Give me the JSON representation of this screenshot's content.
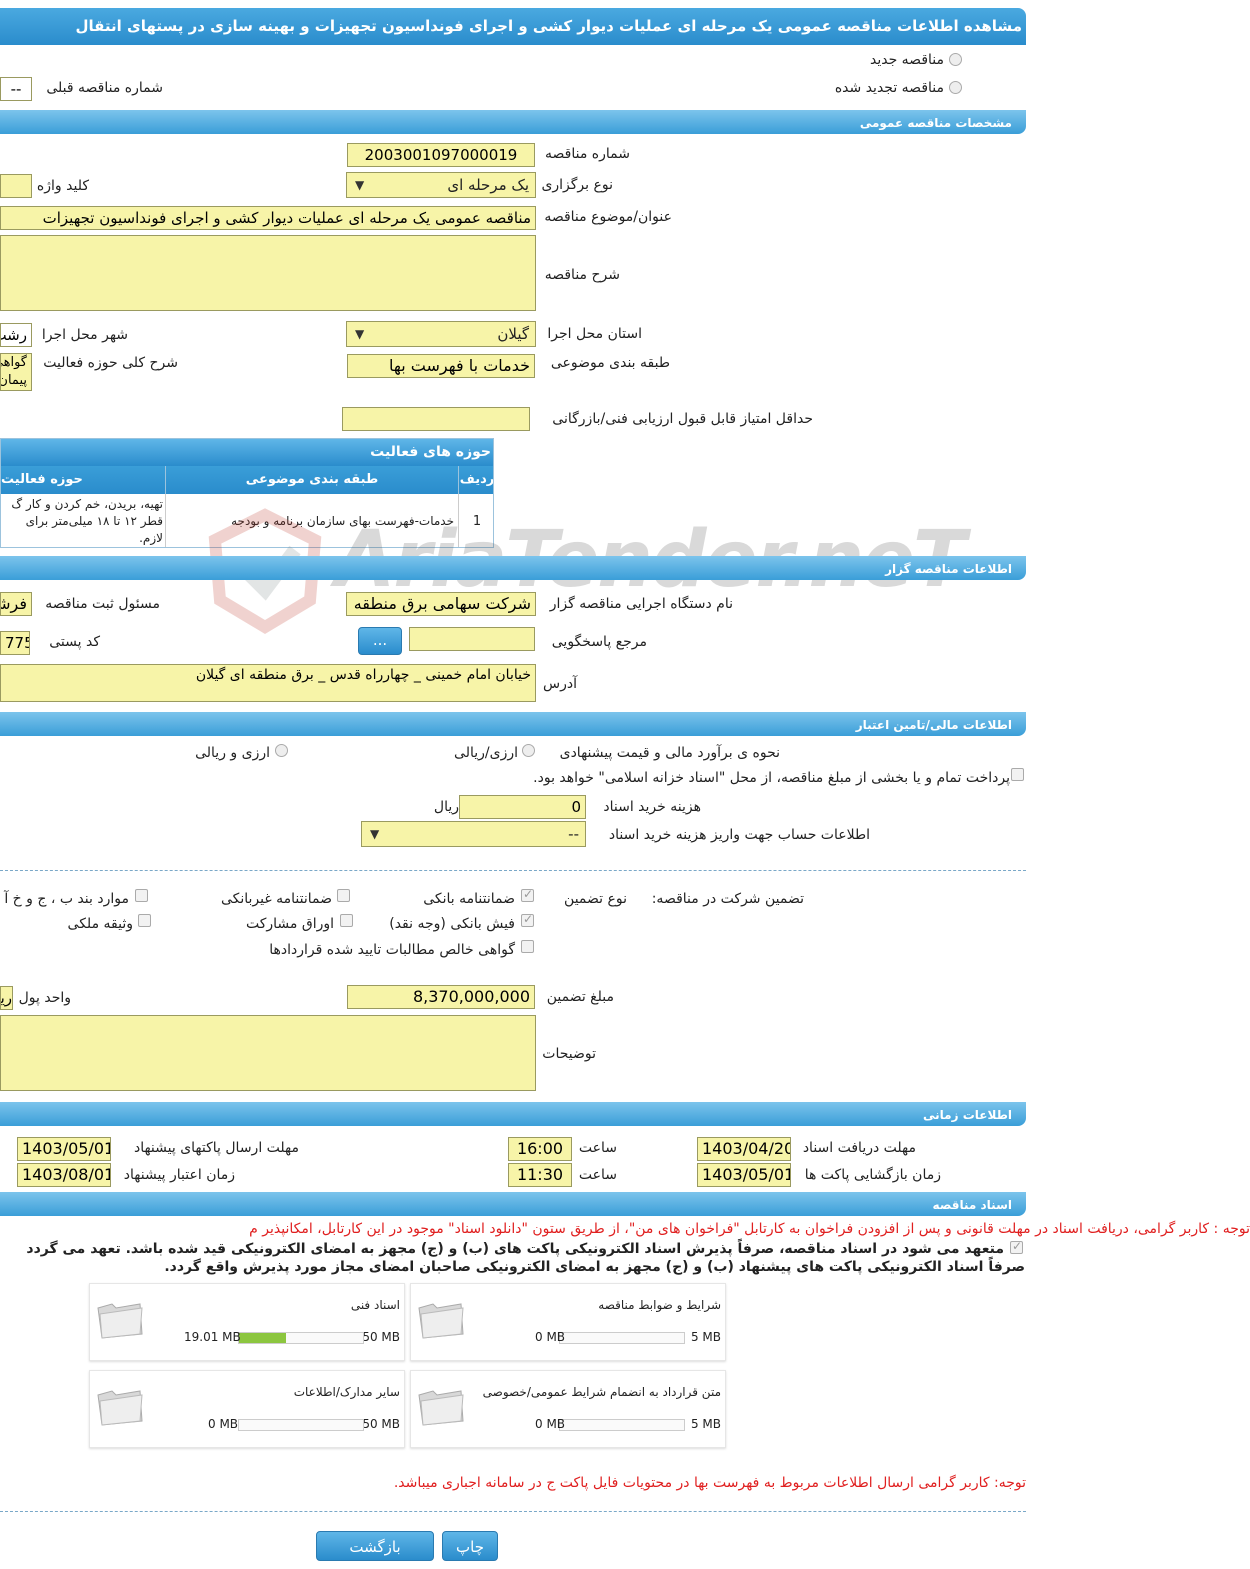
{
  "title": "مشاهده اطلاعات مناقصه عمومی یک مرحله ای عملیات دیوار کشی و اجرای فونداسیون تجهیزات و بهینه سازی در پستهای انتقال",
  "tender_type": {
    "new_label": "مناقصه جدید",
    "renewed_label": "مناقصه تجدید شده",
    "previous_number_label": "شماره مناقصه قبلی",
    "previous_number_value": "--"
  },
  "sections": {
    "general": "مشخصات مناقصه عمومی",
    "organizer": "اطلاعات مناقصه گزار",
    "financial": "اطلاعات مالی/تامین اعتبار",
    "time": "اطلاعات زمانی",
    "documents": "اسناد مناقصه"
  },
  "general": {
    "number_label": "شماره مناقصه",
    "number_value": "2003001097000019",
    "holding_type_label": "نوع برگزاری",
    "holding_type_value": "یک مرحله ای",
    "keyword_label": "کلید واژه",
    "subject_label": "عنوان/موضوع مناقصه",
    "subject_value": "مناقصه عمومی یک مرحله ای عملیات دیوار کشی و اجرای فونداسیون تجهیزات",
    "description_label": "شرح مناقصه",
    "province_label": "استان محل اجرا",
    "province_value": "گیلان",
    "city_label": "شهر محل اجرا",
    "city_value": "رشت",
    "category_label": "طبقه بندی موضوعی",
    "category_value": "خدمات با فهرست بها",
    "activity_desc_label": "شرح کلی حوزه فعالیت",
    "activity_desc_value": "گواهی پیمان",
    "min_score_label": "حداقل امتیاز قابل قبول ارزیابی فنی/بازرگانی"
  },
  "activity_table": {
    "title": "حوزه های فعالیت",
    "headers": [
      "ردیف",
      "طبقه بندی موضوعی",
      "حوزه فعالیت"
    ],
    "rows": [
      {
        "index": "1",
        "category": "خدمات-فهرست بهای سازمان برنامه و بودجه",
        "activity_lines": [
          "تهیه، بریدن، خم کردن و کار گ",
          "قطر ۱۲ تا ۱۸ میلی‌متر برای",
          "لازم."
        ]
      }
    ]
  },
  "organizer": {
    "agency_label": "نام دستگاه اجرایی مناقصه گزار",
    "agency_value": "شرکت سهامی برق منطقه",
    "registrar_label": "مسئول ثبت مناقصه",
    "registrar_value": "فرشید",
    "reference_label": "مرجع پاسخگویی",
    "browse_button": "...",
    "postal_label": "کد پستی",
    "postal_value": "775",
    "address_label": "آدرس",
    "address_value": "خیابان امام خمینی _ چهارراه قدس _ برق منطقه ای گیلان"
  },
  "financial": {
    "estimate_label": "نحوه ی برآورد مالی و قیمت پیشنهادی",
    "option_rial": "ارزی/ریالی",
    "option_currency": "ارزی و ریالی",
    "treasury_text": "پرداخت تمام و یا بخشی از مبلغ مناقصه، از محل \"اسناد خزانه اسلامی\" خواهد بود.",
    "doc_cost_label": "هزینه خرید اسناد",
    "doc_cost_value": "0",
    "doc_cost_unit": "ریال",
    "account_label": "اطلاعات حساب جهت واریز هزینه خرید اسناد",
    "account_value": "--"
  },
  "guarantee": {
    "participation_label": "تضمین شرکت در مناقصه:",
    "type_label": "نوع تضمین",
    "bank_guarantee": "ضمانتنامه بانکی",
    "non_bank_guarantee": "ضمانتنامه غیربانکی",
    "items_bcg": "موارد بند ب ، ج و خ آ",
    "bank_receipt": "فیش بانکی (وجه نقد)",
    "partnership_bonds": "اوراق مشارکت",
    "property_bond": "وثیقه ملکی",
    "receivables_cert": "گواهی خالص مطالبات تایید شده قراردادها",
    "amount_label": "مبلغ تضمین",
    "amount_value": "8,370,000,000",
    "currency_label": "واحد پول",
    "currency_value": "ریال",
    "notes_label": "توضیحات"
  },
  "time": {
    "receive_docs_label": "مهلت دریافت اسناد",
    "receive_docs_date": "1403/04/20",
    "receive_docs_hour_label": "ساعت",
    "receive_docs_hour": "16:00",
    "submit_label": "مهلت ارسال پاکتهای پیشنهاد",
    "submit_date": "1403/05/01",
    "opening_label": "زمان بازگشایی پاکت ها",
    "opening_date": "1403/05/01",
    "opening_hour_label": "ساعت",
    "opening_hour": "11:30",
    "validity_label": "زمان اعتبار پیشنهاد",
    "validity_date": "1403/08/01"
  },
  "documents": {
    "notice_red": "توجه : کاربر گرامی، دریافت اسناد در مهلت قانونی و پس از افزودن فراخوان به کارتابل \"فراخوان های من\"، از طریق ستون \"دانلود اسناد\" موجود در این کارتابل، امکانپذیر م",
    "commit_line1": "متعهد می شود در اسناد مناقصه، صرفاً پذیرش اسناد الکترونیکی پاکت های (ب) و (ج) مجهز به امضای الکترونیکی قید شده باشد. تعهد می گردد",
    "commit_line2": "صرفاً اسناد الکترونیکی پاکت های پیشنهاد (ب) و (ج) مجهز به امضای الکترونیکی صاحبان امضای مجاز مورد پذیرش واقع گردد.",
    "folders": [
      {
        "name": "شرایط و ضوابط مناقصه",
        "used": "0 MB",
        "max": "5 MB",
        "fraction": 0
      },
      {
        "name": "اسناد فنی",
        "used": "19.01 MB",
        "max": "50 MB",
        "fraction": 0.38
      },
      {
        "name": "متن قرارداد به انضمام شرایط عمومی/خصوصی",
        "used": "0 MB",
        "max": "5 MB",
        "fraction": 0
      },
      {
        "name": "سایر مدارک/اطلاعات",
        "used": "0 MB",
        "max": "50 MB",
        "fraction": 0
      }
    ],
    "bottom_notice": "توجه: کاربر گرامی ارسال اطلاعات مربوط به فهرست بها در محتویات فایل پاکت ج در سامانه اجباری میباشد."
  },
  "buttons": {
    "print": "چاپ",
    "back": "بازگشت"
  },
  "watermark": "AriaTender.neT",
  "colors": {
    "header_blue": "#3a9ed8",
    "input_yellow": "#f7f4a8",
    "notice_red": "#e02020",
    "progress_green": "#8cc63f"
  }
}
